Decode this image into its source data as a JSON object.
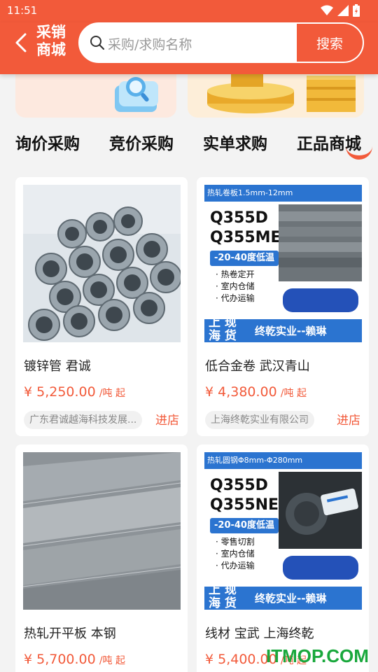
{
  "status_bar": {
    "time": "11:51"
  },
  "header": {
    "title_line1": "采销",
    "title_line2": "商城",
    "search_placeholder": "采购/求购名称",
    "search_button": "搜索"
  },
  "tabs": [
    "询价采购",
    "竞价采购",
    "实单求购",
    "正品商城"
  ],
  "products": [
    {
      "name": "镀锌管 君诚",
      "price": "¥ 5,250.00",
      "unit": "/吨 起",
      "shop": "广东君诚越海科技发展...",
      "store_button": "进店"
    },
    {
      "name": "低合金卷 武汉青山",
      "price": "¥ 4,380.00",
      "unit": "/吨 起",
      "shop": "上海终乾实业有限公司",
      "store_button": "进店",
      "ad": {
        "top": "热轧卷板1.5mm-12mm",
        "grade1": "Q355D",
        "grade2": "Q355ME",
        "temp": "-20-40度低温",
        "line1": "· 热卷定开",
        "line2": "· 室内仓储",
        "line3": "· 代办运输",
        "tag1": "上 现",
        "tag2": "海 货",
        "company": "终乾实业--赖琳"
      }
    },
    {
      "name": "热轧开平板 本钢",
      "price": "¥ 5,700.00",
      "unit": "/吨 起"
    },
    {
      "name": "线材 宝武 上海终乾",
      "price": "¥ 5,400.00",
      "unit": "/吨 起",
      "ad": {
        "top": "热轧圆钢Φ8mm-Φ280mm",
        "grade1": "Q355D",
        "grade2": "Q355NE",
        "temp": "-20-40度低温",
        "line1": "· 零售切割",
        "line2": "· 室内仓储",
        "line3": "· 代办运输",
        "tag1": "上 现",
        "tag2": "海 货",
        "company": "终乾实业--赖琳"
      }
    }
  ],
  "watermark": "ITMOP.COM",
  "colors": {
    "accent": "#f25a3a",
    "blue": "#2b74d0",
    "watermark": "#19a83c"
  }
}
